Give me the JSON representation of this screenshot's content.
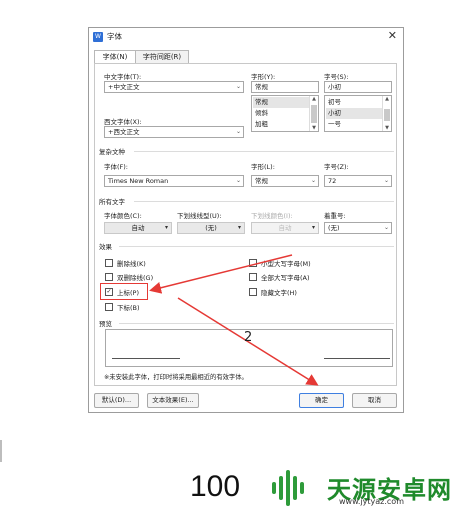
{
  "dialog": {
    "title": "字体",
    "close_glyph": "✕",
    "tabs": [
      {
        "label": "字体(N)",
        "active": true
      },
      {
        "label": "字符间距(R)",
        "active": false
      }
    ]
  },
  "font": {
    "chinese_font_label": "中文字体(T):",
    "chinese_font_value": "+中文正文",
    "western_font_label": "西文字体(X):",
    "western_font_value": "+西文正文",
    "style_label": "字形(Y):",
    "style_value": "常规",
    "style_options": [
      "常规",
      "倾斜",
      "加粗"
    ],
    "size_label": "字号(S):",
    "size_value": "小初",
    "size_options": [
      "初号",
      "小初",
      "一号"
    ]
  },
  "complex": {
    "section_title": "复杂文种",
    "font_label": "字体(F):",
    "font_value": "Times New Roman",
    "style_label": "字形(L):",
    "style_value": "常规",
    "size_label": "字号(Z):",
    "size_value": "72"
  },
  "alltext": {
    "section_title": "所有文字",
    "color_label": "字体颜色(C):",
    "color_value": "自动",
    "underline_label": "下划线线型(U):",
    "underline_value": "(无)",
    "underline_color_label": "下划线颜色(I):",
    "underline_color_value": "自动",
    "emphasis_label": "着重号:",
    "emphasis_value": "(无)"
  },
  "effects": {
    "section_title": "效果",
    "items": [
      {
        "label": "删除线(K)",
        "checked": false
      },
      {
        "label": "双删除线(G)",
        "checked": false
      },
      {
        "label": "上标(P)",
        "checked": true
      },
      {
        "label": "下标(B)",
        "checked": false
      },
      {
        "label": "小型大写字母(M)",
        "checked": false
      },
      {
        "label": "全部大写字母(A)",
        "checked": false
      },
      {
        "label": "隐藏文字(H)",
        "checked": false
      }
    ]
  },
  "preview": {
    "section_title": "预览",
    "note": "※未安装此字体，打印时将采用最相近的有效字体。"
  },
  "buttons": {
    "default": "默认(D)...",
    "text_effects": "文本效果(E)...",
    "ok": "确定",
    "cancel": "取消"
  },
  "annotation": {
    "step_number": "2",
    "color": "#e53935"
  },
  "watermark": {
    "left_text": "100",
    "brand": "天源安卓网",
    "url": "www.jytyaz.com",
    "brand_color": "#1f8a2b"
  }
}
